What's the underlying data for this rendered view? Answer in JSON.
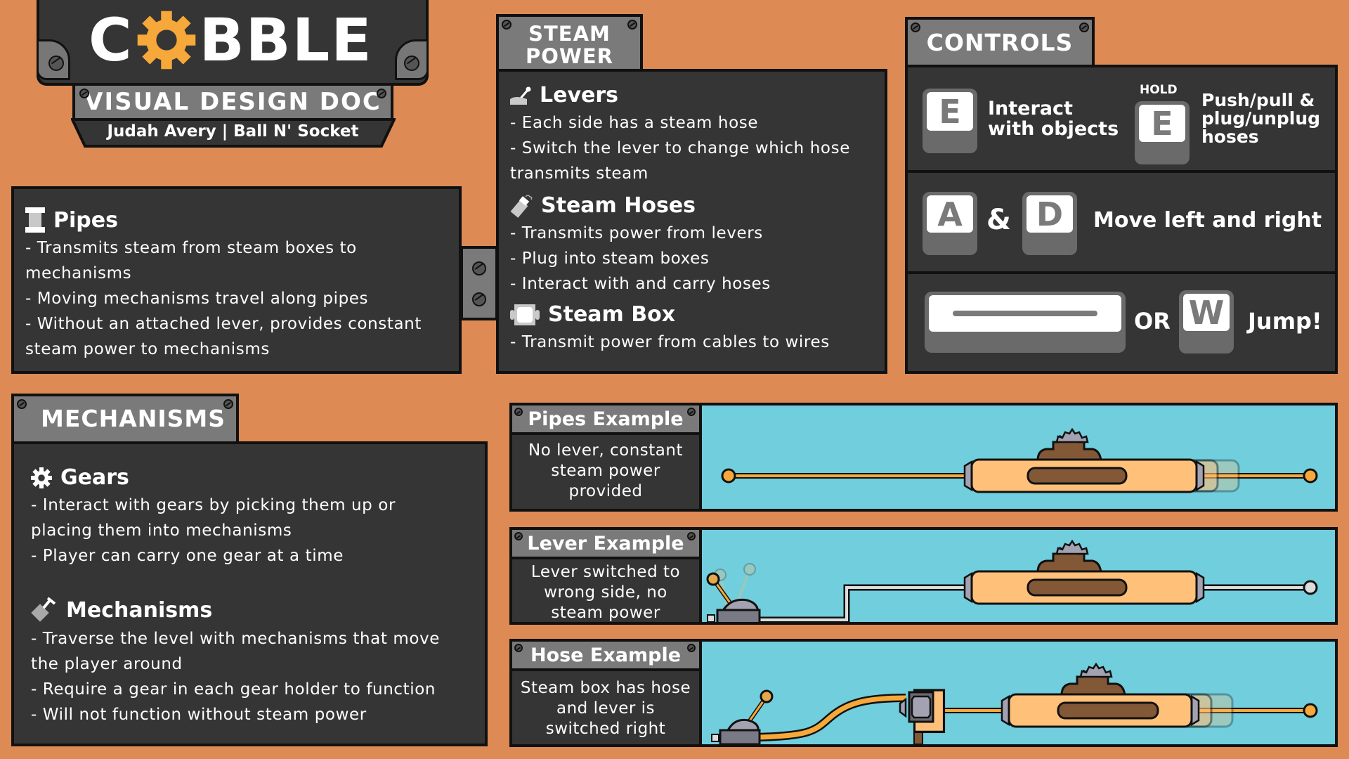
{
  "header": {
    "logo_prefix": "C",
    "logo_suffix": "BBLE",
    "logo_gear_color": "#f7a83a",
    "subtitle": "VISUAL DESIGN DOC",
    "credits": "Judah Avery | Ball N' Socket"
  },
  "pipes_panel": {
    "title": "Pipes",
    "icon": "pipe-icon",
    "lines": [
      "- Transmits steam from steam boxes to",
      "mechanisms",
      "- Moving mechanisms travel along pipes",
      "- Without an attached lever, provides constant",
      "steam power to mechanisms"
    ]
  },
  "steam_power": {
    "tab_line1": "STEAM",
    "tab_line2": "POWER",
    "sections": [
      {
        "title": "Levers",
        "icon": "lever-icon",
        "lines": [
          "- Each side has a steam hose",
          "- Switch the lever to change which hose",
          "transmits steam"
        ]
      },
      {
        "title": "Steam Hoses",
        "icon": "hose-icon",
        "lines": [
          "- Transmits power from levers",
          "- Plug into steam boxes",
          "- Interact with and carry hoses"
        ]
      },
      {
        "title": "Steam Box",
        "icon": "steam-box-icon",
        "lines": [
          "- Transmit power from cables to wires"
        ]
      }
    ]
  },
  "controls": {
    "tab": "CONTROLS",
    "rows": [
      {
        "key": "E",
        "label_line1": "Interact",
        "label_line2": "with objects",
        "hold_label": "HOLD",
        "hold_key": "E",
        "hold_line1": "Push/pull &",
        "hold_line2": "plug/unplug",
        "hold_line3": "hoses"
      },
      {
        "key1": "A",
        "joiner": "&",
        "key2": "D",
        "label": "Move left and right"
      },
      {
        "key1": "space",
        "joiner": "OR",
        "key2": "W",
        "label": "Jump!"
      }
    ]
  },
  "mechanisms": {
    "tab": "MECHANISMS",
    "sections": [
      {
        "title": "Gears",
        "icon": "gear-icon",
        "lines": [
          "- Interact with gears by picking them up or",
          "placing them into mechanisms",
          "- Player can carry one gear at a time"
        ]
      },
      {
        "title": "Mechanisms",
        "icon": "mechanism-icon",
        "lines": [
          "- Traverse the level with mechanisms that move",
          "the player around",
          "- Require a gear in each gear holder to function",
          "- Will not function without steam power"
        ]
      }
    ]
  },
  "examples": [
    {
      "title": "Pipes Example",
      "desc_lines": [
        "No lever, constant",
        "steam power",
        "provided"
      ]
    },
    {
      "title": "Lever Example",
      "desc_lines": [
        "Lever switched to",
        "wrong side, no",
        "steam power"
      ]
    },
    {
      "title": "Hose Example",
      "desc_lines": [
        "Steam box has hose",
        "and lever is",
        "switched right"
      ]
    }
  ],
  "colors": {
    "background": "#dd8a55",
    "panel": "#353535",
    "tab": "#7a7a7b",
    "scene": "#70cedd",
    "steam_pipe": "#f7a83a",
    "unpowered_pipe": "#dcdcdc",
    "mechanism_body": "#ffc07a",
    "mechanism_slot": "#825836"
  }
}
